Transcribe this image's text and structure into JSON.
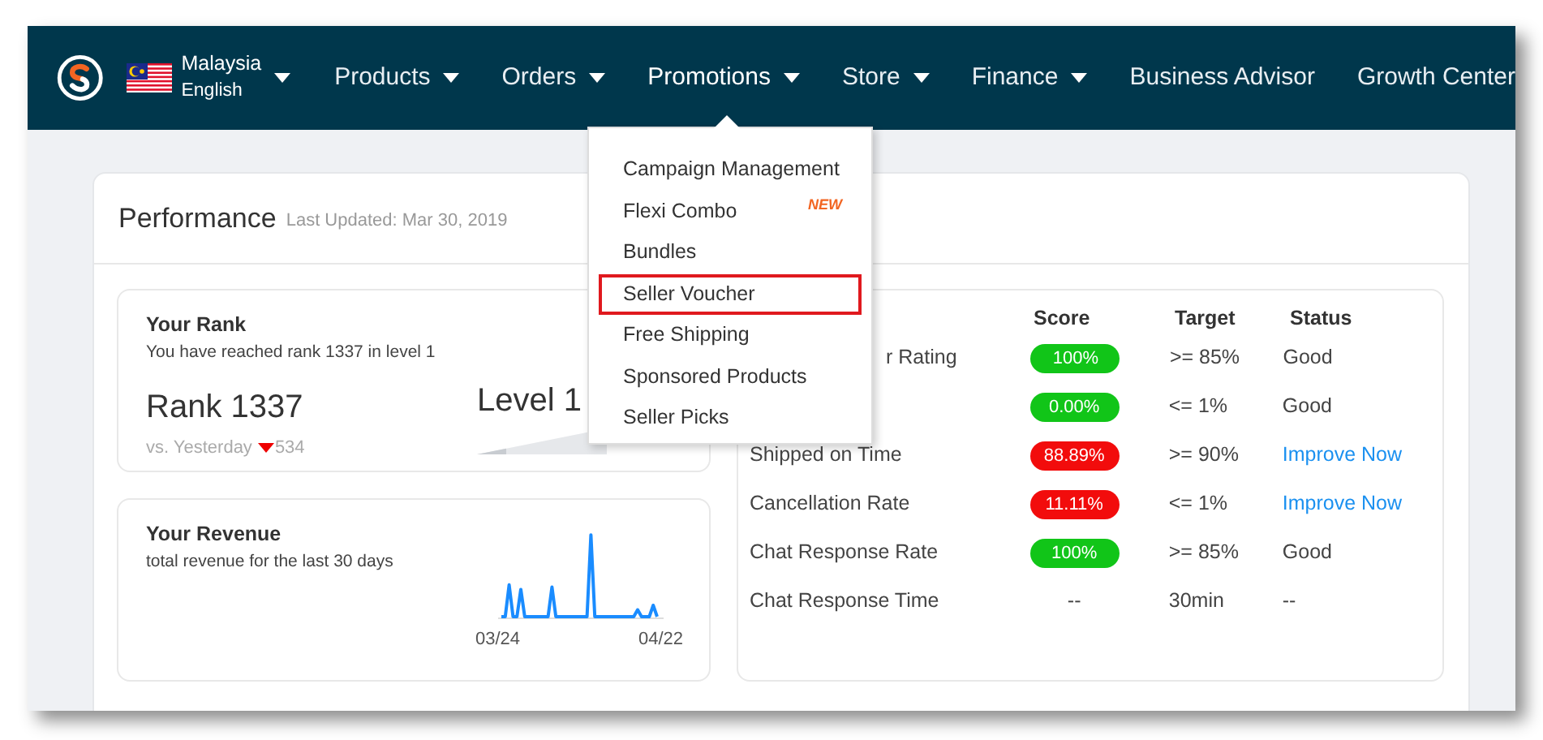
{
  "nav": {
    "locale": {
      "country": "Malaysia",
      "language": "English"
    },
    "items": [
      {
        "label": "Products",
        "kind": "dropdown",
        "selected": false
      },
      {
        "label": "Orders",
        "kind": "dropdown",
        "selected": false
      },
      {
        "label": "Promotions",
        "kind": "dropdown",
        "selected": true
      },
      {
        "label": "Store",
        "kind": "dropdown",
        "selected": false
      },
      {
        "label": "Finance",
        "kind": "dropdown",
        "selected": false
      },
      {
        "label": "Business Advisor",
        "kind": "link",
        "selected": false
      },
      {
        "label": "Growth Center",
        "kind": "link",
        "selected": false
      }
    ]
  },
  "dropdown": {
    "items": [
      {
        "label": "Campaign Management",
        "highlighted": false
      },
      {
        "label": "Flexi Combo",
        "badge": "NEW",
        "highlighted": false
      },
      {
        "label": "Bundles",
        "highlighted": false
      },
      {
        "label": "Seller Voucher",
        "highlighted": true
      },
      {
        "label": "Free Shipping",
        "highlighted": false
      },
      {
        "label": "Sponsored Products",
        "highlighted": false
      },
      {
        "label": "Seller Picks",
        "highlighted": false
      }
    ]
  },
  "performance": {
    "title": "Performance",
    "updated": "Last Updated: Mar 30, 2019",
    "rank": {
      "title": "Your Rank",
      "subtitle": "You have reached rank 1337 in level 1",
      "rank": "Rank 1337",
      "compare": "vs. Yesterday",
      "change": "534",
      "level": "Level 1"
    },
    "revenue": {
      "title": "Your Revenue",
      "subtitle": "total revenue for the last 30 days",
      "start": "03/24",
      "end": "04/22"
    },
    "metrics": {
      "columns": [
        "Score",
        "Target",
        "Status"
      ],
      "rows": [
        {
          "name": "r Rating",
          "kind": "cut",
          "score": "100%",
          "ok": true,
          "target": ">= 85%",
          "status": "Good"
        },
        {
          "score": "0.00%",
          "ok": true,
          "target": "<= 1%",
          "status": "Good"
        },
        {
          "name": "Shipped on Time",
          "score": "88.89%",
          "ok": false,
          "target": ">= 90%",
          "status": "Improve Now"
        },
        {
          "name": "Cancellation Rate",
          "score": "11.11%",
          "ok": false,
          "target": "<= 1%",
          "status": "Improve Now"
        },
        {
          "name": "Chat Response Rate",
          "score": "100%",
          "ok": true,
          "target": ">= 85%",
          "status": "Good"
        },
        {
          "name": "Chat Response Time",
          "score": "--",
          "kind": "plain",
          "target": "30min",
          "status": "--"
        }
      ]
    }
  }
}
